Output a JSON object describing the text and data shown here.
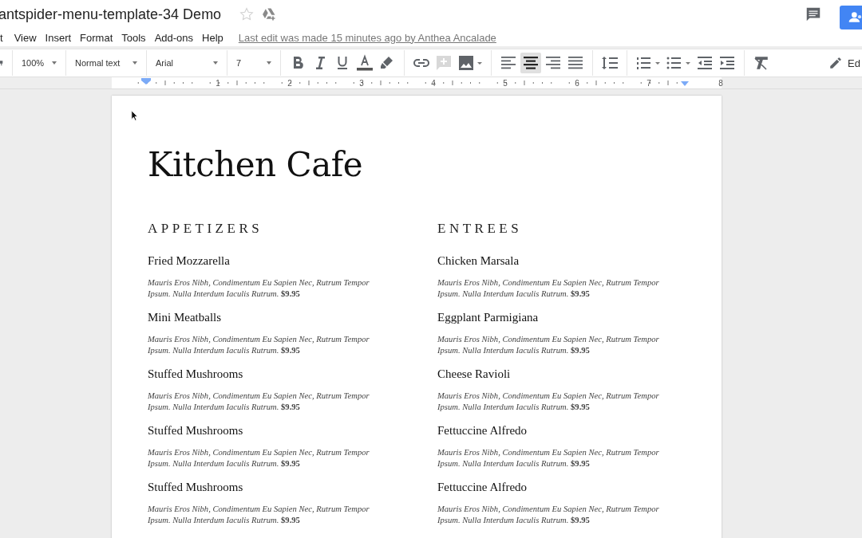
{
  "document": {
    "title": "antspider-menu-template-34 Demo",
    "starred": false
  },
  "menu": [
    "t",
    "View",
    "Insert",
    "Format",
    "Tools",
    "Add-ons",
    "Help"
  ],
  "last_edit": "Last edit was made 15 minutes ago by Anthea Ancalade",
  "toolbar": {
    "zoom": "100%",
    "style": "Normal text",
    "font": "Arial",
    "size": "7",
    "alignment": [
      {
        "kind": "left",
        "selected": false
      },
      {
        "kind": "center",
        "selected": true
      },
      {
        "kind": "right",
        "selected": false
      },
      {
        "kind": "justify",
        "selected": false
      }
    ],
    "mode_button": "Ed"
  },
  "ruler": [
    "1",
    "2",
    "3",
    "4",
    "5",
    "6",
    "7",
    "8"
  ],
  "page": {
    "heading": "Kitchen Cafe",
    "sections": [
      {
        "title": "APPETIZERS",
        "items": [
          {
            "name": "Fried Mozzarella",
            "description": "*Mauris Eros Nibh, Condimentum Eu Sapien Nec, Rutrum Tempor Ipsum. Nulla Interdum Iaculis Rutrum.*  **$9.95**"
          },
          {
            "name": "Mini Meatballs",
            "description": "*Mauris Eros Nibh, Condimentum Eu Sapien Nec, Rutrum Tempor Ipsum. Nulla Interdum Iaculis Rutrum.* **$9.95**"
          },
          {
            "name": "Stuffed Mushrooms",
            "description": "*Mauris Eros Nibh, Condimentum Eu Sapien Nec, Rutrum Tempor Ipsum. Nulla Interdum Iaculis Rutrum.* **$9.95**"
          },
          {
            "name": "Stuffed Mushrooms",
            "description": "*Mauris Eros Nibh, Condimentum Eu Sapien Nec, Rutrum Tempor Ipsum. Nulla Interdum Iaculis Rutrum.* **$9.95**"
          },
          {
            "name": "Stuffed Mushrooms",
            "description": "*Mauris Eros Nibh, Condimentum Eu Sapien Nec, Rutrum Tempor Ipsum. Nulla Interdum Iaculis Rutrum.* **$9.95**"
          }
        ]
      },
      {
        "title": "ENTREES",
        "items": [
          {
            "name": "Chicken Marsala",
            "description": "*Mauris Eros Nibh, Condimentum Eu Sapien Nec, Rutrum Tempor Ipsum. Nulla Interdum Iaculis Rutrum.* **$9.95**"
          },
          {
            "name": "Eggplant Parmigiana",
            "description": "*Mauris Eros Nibh, Condimentum Eu Sapien Nec, Rutrum Tempor Ipsum. Nulla Interdum Iaculis Rutrum.* **$9.95**"
          },
          {
            "name": "Cheese Ravioli",
            "description": "*Mauris Eros Nibh, Condimentum Eu Sapien Nec, Rutrum Tempor Ipsum. Nulla Interdum Iaculis Rutrum.* **$9.95**"
          },
          {
            "name": "Fettuccine Alfredo",
            "description": "*Mauris Eros Nibh, Condimentum Eu Sapien Nec, Rutrum Tempor Ipsum. Nulla Interdum Iaculis Rutrum.* **$9.95**"
          },
          {
            "name": "Fettuccine Alfredo",
            "description": "*Mauris Eros Nibh, Condimentum Eu Sapien Nec, Rutrum Tempor Ipsum. Nulla Interdum Iaculis Rutrum.* **$9.95**"
          }
        ]
      }
    ]
  }
}
